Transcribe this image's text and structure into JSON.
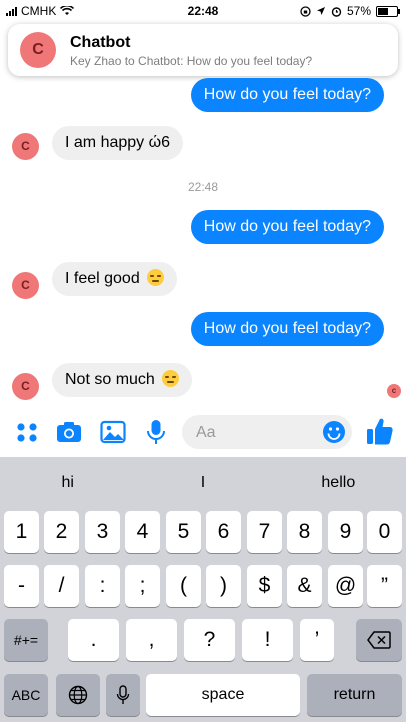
{
  "status_bar": {
    "carrier": "CMHK",
    "time": "22:48",
    "battery": "57%"
  },
  "notification": {
    "avatar_letter": "C",
    "title": "Chatbot",
    "subtitle": "Key Zhao to Chatbot: How do you feel today?"
  },
  "messages": {
    "m1": "How do you feel today?",
    "m2": "I am happy ώ6",
    "timestamp": "22:48",
    "m3": "How do you feel today?",
    "m4": "I feel good",
    "m5": "How do you feel today?",
    "m6": "Not so much",
    "avatar_letter": "C",
    "seen_letter": "c"
  },
  "composer": {
    "placeholder": "Aa"
  },
  "keyboard": {
    "suggestions": [
      "hi",
      "I",
      "hello"
    ],
    "row1": [
      "1",
      "2",
      "3",
      "4",
      "5",
      "6",
      "7",
      "8",
      "9",
      "0"
    ],
    "row2": [
      "-",
      "/",
      ":",
      ";",
      "(",
      ")",
      "$",
      "&",
      "@",
      "”"
    ],
    "row3": [
      ".",
      ",",
      "?",
      "!",
      "’"
    ],
    "symbols_key": "#+=",
    "abc_key": "ABC",
    "space_key": "space",
    "return_key": "return"
  },
  "colors": {
    "accent": "#0a84ff",
    "avatar": "#f07777"
  }
}
